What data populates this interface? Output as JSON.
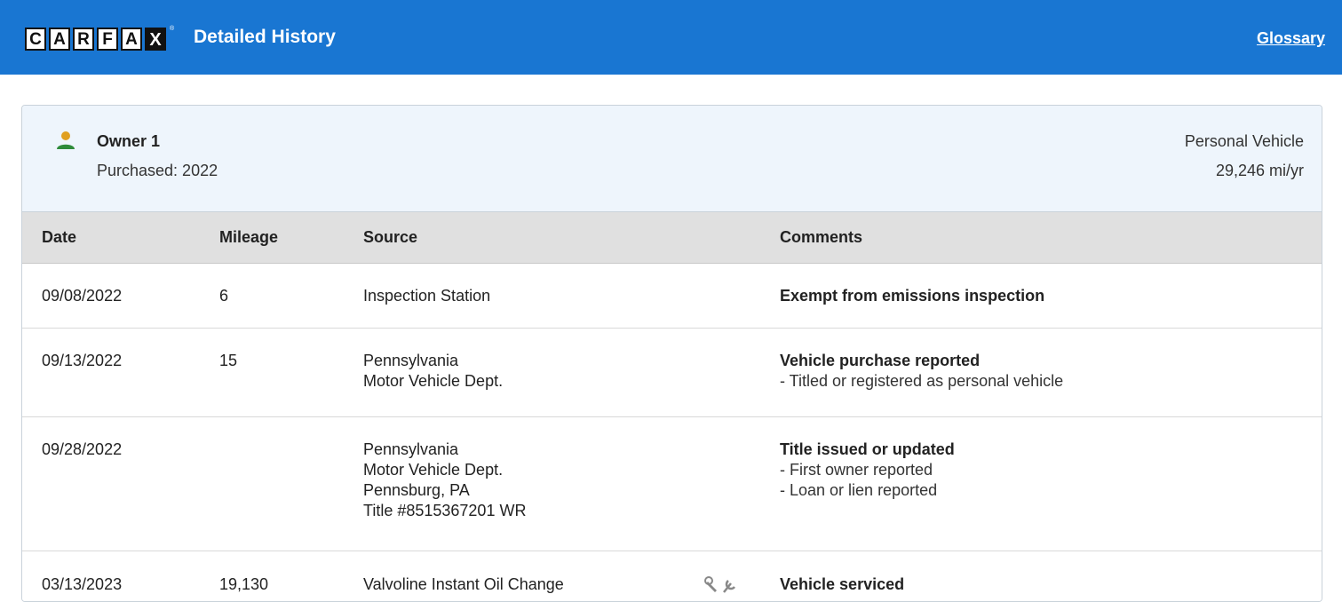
{
  "header": {
    "logo_letters": [
      "C",
      "A",
      "R",
      "F",
      "A",
      "X"
    ],
    "logo_reg": "®",
    "title": "Detailed History",
    "glossary_label": "Glossary",
    "background_color": "#1976d2"
  },
  "owner": {
    "icon": "person-icon",
    "name": "Owner 1",
    "purchased": "Purchased: 2022",
    "usage": "Personal Vehicle",
    "mileage_per_year": "29,246 mi/yr"
  },
  "table": {
    "columns": {
      "date": "Date",
      "mileage": "Mileage",
      "source": "Source",
      "comments": "Comments"
    },
    "rows": [
      {
        "date": "09/08/2022",
        "mileage": "6",
        "source": [
          "Inspection Station"
        ],
        "comment_title": "Exempt from emissions inspection",
        "comment_details": []
      },
      {
        "date": "09/13/2022",
        "mileage": "15",
        "source": [
          "Pennsylvania",
          "Motor Vehicle Dept."
        ],
        "comment_title": "Vehicle purchase reported",
        "comment_details": [
          "- Titled or registered as personal vehicle"
        ]
      },
      {
        "date": "09/28/2022",
        "mileage": "",
        "source": [
          "Pennsylvania",
          "Motor Vehicle Dept.",
          "Pennsburg, PA",
          "Title #8515367201 WR"
        ],
        "comment_title": "Title issued or updated",
        "comment_details": [
          "- First owner reported",
          "- Loan or lien reported"
        ]
      },
      {
        "date": "03/13/2023",
        "mileage": "19,130",
        "source": [
          "Valvoline Instant Oil Change"
        ],
        "source_icon": "wrench-icon",
        "comment_title": "Vehicle serviced",
        "comment_details": []
      }
    ]
  }
}
